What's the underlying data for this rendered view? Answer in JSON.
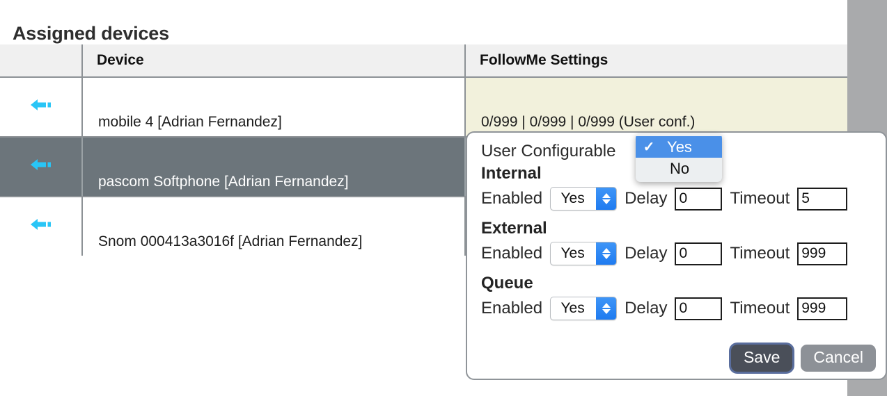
{
  "page": {
    "title": "Assigned devices"
  },
  "table": {
    "columns": [
      {
        "key": "arrow",
        "label": ""
      },
      {
        "key": "device",
        "label": "Device"
      },
      {
        "key": "follow",
        "label": "FollowMe Settings"
      }
    ],
    "rows": [
      {
        "icon": "back-arrow-icon",
        "device": "mobile 4 [Adrian Fernandez]",
        "followme": "0/999 | 0/999 | 0/999 (User conf.)",
        "selected": false
      },
      {
        "icon": "back-arrow-icon",
        "device": "pascom Softphone [Adrian Fernandez]",
        "followme": "",
        "selected": true
      },
      {
        "icon": "back-arrow-icon",
        "device": "Snom 000413a3016f [Adrian Fernandez]",
        "followme": "",
        "selected": false
      }
    ]
  },
  "settings_panel": {
    "user_configurable_label": "User Configurable",
    "user_configurable_value": "Yes",
    "sections": [
      {
        "heading": "Internal",
        "enabled_label": "Enabled",
        "enabled_value": "Yes",
        "delay_label": "Delay",
        "delay_value": "0",
        "timeout_label": "Timeout",
        "timeout_value": "5"
      },
      {
        "heading": "External",
        "enabled_label": "Enabled",
        "enabled_value": "Yes",
        "delay_label": "Delay",
        "delay_value": "0",
        "timeout_label": "Timeout",
        "timeout_value": "999"
      },
      {
        "heading": "Queue",
        "enabled_label": "Enabled",
        "enabled_value": "Yes",
        "delay_label": "Delay",
        "delay_value": "0",
        "timeout_label": "Timeout",
        "timeout_value": "999"
      }
    ],
    "save_label": "Save",
    "cancel_label": "Cancel"
  },
  "dropdown": {
    "open": true,
    "checkmark": "✓",
    "options": [
      {
        "label": "Yes",
        "selected": true
      },
      {
        "label": "No",
        "selected": false
      }
    ]
  },
  "colors": {
    "selected_row": "#6c757b",
    "followme_cell": "#f2f1dc",
    "header_bg": "#f0f0f0",
    "border": "#8d9296",
    "accent_blue": "#4a90e8",
    "stepper_blue": "#2a84f2",
    "arrow_icon": "#29c5f6",
    "gutter": "#a9aaac",
    "save_bg": "#4a4f59",
    "cancel_bg": "#8d9197"
  }
}
